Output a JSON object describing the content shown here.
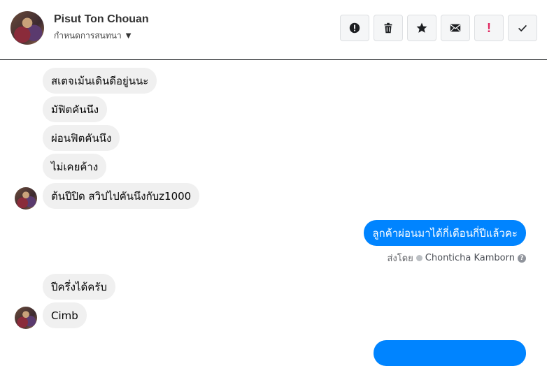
{
  "header": {
    "contact_name": "Pisut Ton Chouan",
    "assign_label": "กำหนดการสนทนา",
    "toolbar": {
      "spam_icon": "alert-circle-icon",
      "delete_icon": "trash-icon",
      "star_icon": "star-icon",
      "mark_unread_icon": "envelope-icon",
      "important_label": "!",
      "done_icon": "check-icon"
    }
  },
  "messages": [
    {
      "text": "สเตจเม้นเดินดีอยู่นนะ",
      "dir": "in"
    },
    {
      "text": "มัฟิตคันนึง",
      "dir": "in"
    },
    {
      "text": "ผ่อนฟิตคันนึง",
      "dir": "in"
    },
    {
      "text": "ไม่เคยค้าง",
      "dir": "in"
    },
    {
      "text": "ต้นปีปิด สวิปไปคันนึงกับz1000",
      "dir": "in"
    },
    {
      "text": "ลูกค้าผ่อนมาได้กี่เดือนกี่ปีแล้วคะ",
      "dir": "out"
    },
    {
      "text": "ปีครึ่งได้ครับ",
      "dir": "in"
    },
    {
      "text": "Cimb",
      "dir": "in"
    }
  ],
  "sent_by": {
    "prefix": "ส่งโดย",
    "agent": "Chonticha Kamborn",
    "help": "?"
  }
}
